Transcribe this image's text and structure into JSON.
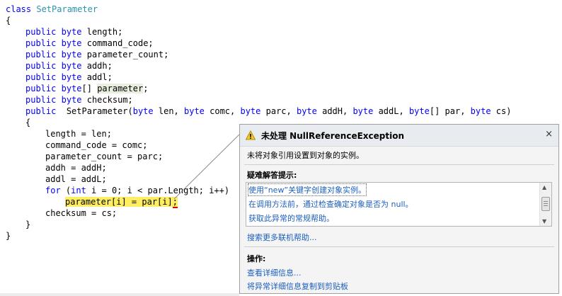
{
  "code": {
    "l1": {
      "kw": "class",
      "type": "SetParameter"
    },
    "l2": {
      "text": "{"
    },
    "l3": {
      "kw1": "public",
      "kw2": "byte",
      "rest": "length;"
    },
    "l4": {
      "kw1": "public",
      "kw2": "byte",
      "rest": "command_code;"
    },
    "l5": {
      "kw1": "public",
      "kw2": "byte",
      "rest": "parameter_count;"
    },
    "l6": {
      "kw1": "public",
      "kw2": "byte",
      "rest": "addh;"
    },
    "l7": {
      "kw1": "public",
      "kw2": "byte",
      "rest": "addl;"
    },
    "l8": {
      "kw1": "public",
      "kw2": "byte",
      "brackets": "[]",
      "hl": "parameter",
      "rest": ";"
    },
    "l9": {
      "kw1": "public",
      "kw2": "byte",
      "rest": "checksum;"
    },
    "l10": {
      "kw1": "public",
      "name": "SetParameter(",
      "t1": "byte",
      "p1": " len, ",
      "t2": "byte",
      "p2": " comc, ",
      "t3": "byte",
      "p3": " parc, ",
      "t4": "byte",
      "p4": " addH, ",
      "t5": "byte",
      "p5": " addL, ",
      "t6": "byte",
      "p6": "[] par, ",
      "t7": "byte",
      "p7": " cs)"
    },
    "l11": {
      "text": "{"
    },
    "l12": {
      "text": "length = len;"
    },
    "l13": {
      "text": "command_code = comc;"
    },
    "l14": {
      "text": "parameter_count = parc;"
    },
    "l15": {
      "text": "addh = addH;"
    },
    "l16": {
      "text": "addl = addL;"
    },
    "l17": {
      "kw": "for",
      "a": " (",
      "kw2": "int",
      "b": " i = 0; i < par.Length; i++)"
    },
    "l18": {
      "hl": "parameter[i] = par[i]",
      "sq": ";"
    },
    "l19": {
      "text": "checksum = cs;"
    },
    "l20": {
      "text": "}"
    },
    "l21": {
      "text": "}"
    }
  },
  "exception": {
    "title": "未处理 NullReferenceException",
    "close": "×",
    "message": "未将对象引用设置到对象的实例。",
    "tips_title": "疑难解答提示:",
    "tips": [
      "使用“new”关键字创建对象实例。",
      "在调用方法前，通过检查确定对象是否为 null。",
      "获取此异常的常规帮助。"
    ],
    "search_link": "搜索更多联机帮助...",
    "actions_title": "操作:",
    "actions": [
      "查看详细信息...",
      "将异常详细信息复制到剪贴板"
    ]
  },
  "colors": {
    "keyword": "#0000ff",
    "type": "#2b91af",
    "current_line": "#ffee62",
    "link": "#1c5fbd"
  },
  "icons": {
    "warning": "warning-icon",
    "close": "close-icon"
  }
}
